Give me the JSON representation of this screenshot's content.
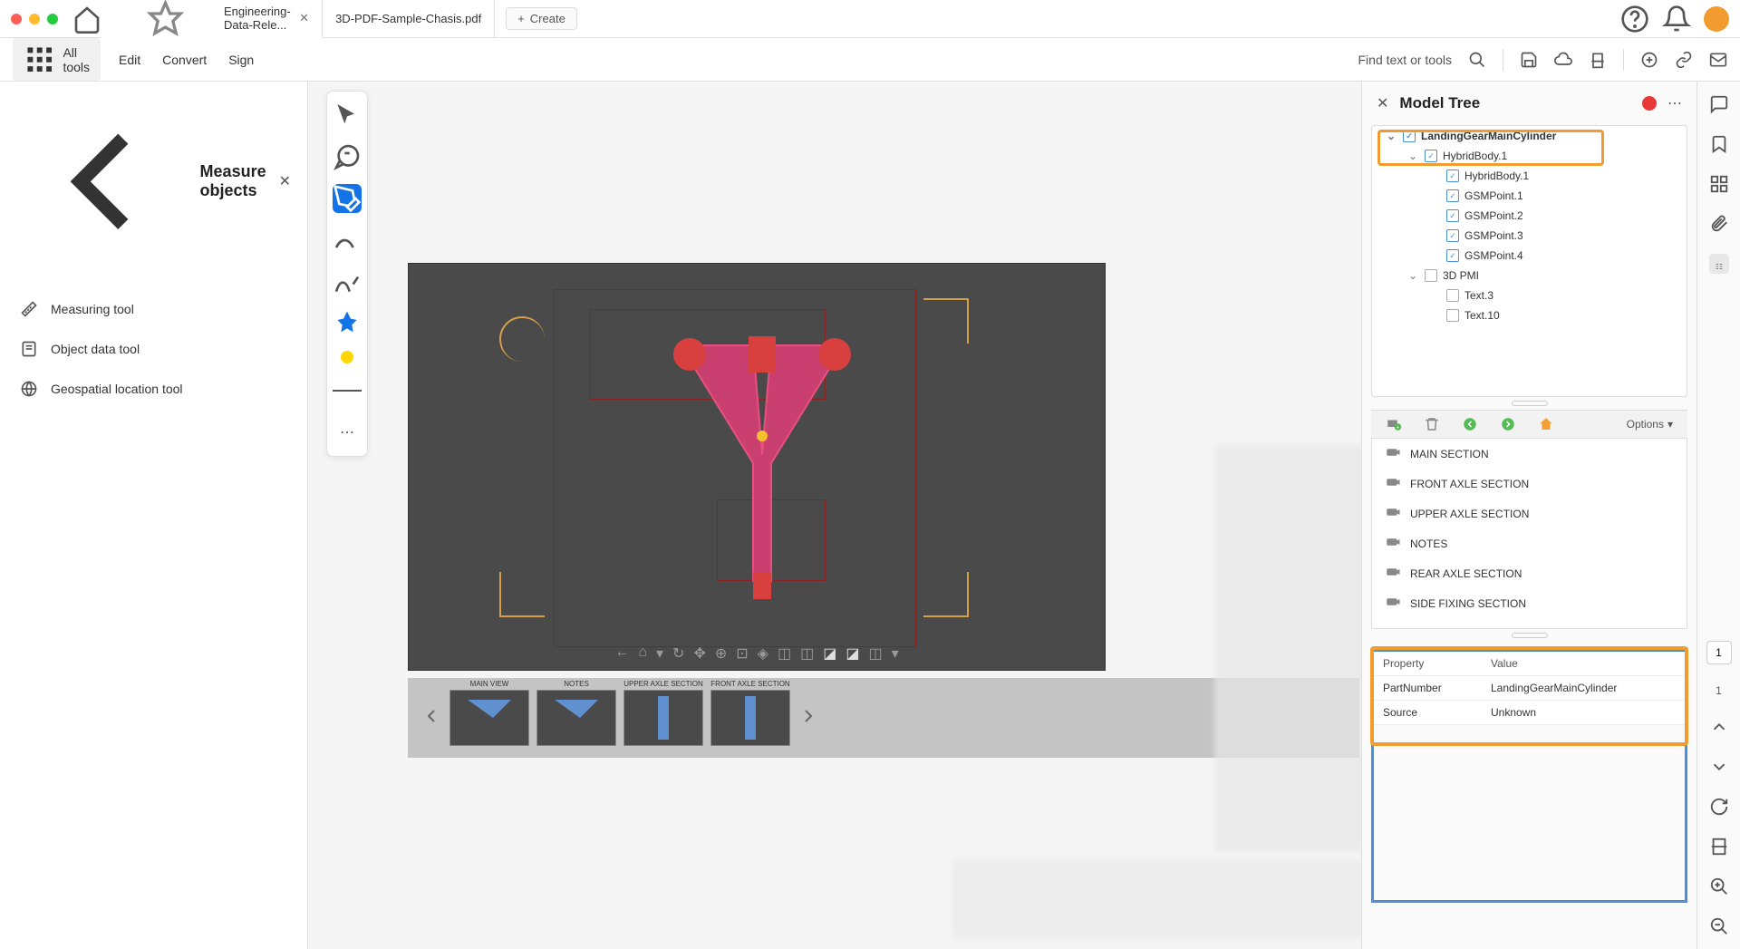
{
  "titlebar": {
    "tab1": "Engineering-Data-Rele...",
    "tab2": "3D-PDF-Sample-Chasis.pdf",
    "create": "Create"
  },
  "toolbar": {
    "all_tools": "All tools",
    "edit": "Edit",
    "convert": "Convert",
    "sign": "Sign",
    "find": "Find text or tools"
  },
  "left_panel": {
    "title": "Measure objects",
    "items": [
      "Measuring tool",
      "Object data tool",
      "Geospatial location tool"
    ]
  },
  "thumbs": [
    "MAIN VIEW",
    "NOTES",
    "UPPER AXLE SECTION",
    "FRONT AXLE SECTION"
  ],
  "model_tree": {
    "title": "Model Tree",
    "root": "LandingGearMainCylinder",
    "items": [
      {
        "label": "HybridBody.1",
        "level": 2,
        "checked": true,
        "chev": true
      },
      {
        "label": "HybridBody.1",
        "level": 3,
        "checked": true
      },
      {
        "label": "GSMPoint.1",
        "level": 3,
        "checked": true
      },
      {
        "label": "GSMPoint.2",
        "level": 3,
        "checked": true
      },
      {
        "label": "GSMPoint.3",
        "level": 3,
        "checked": true
      },
      {
        "label": "GSMPoint.4",
        "level": 3,
        "checked": true
      },
      {
        "label": "3D PMI",
        "level": 2,
        "checked": false,
        "chev": true
      },
      {
        "label": "Text.3",
        "level": 3,
        "checked": false
      },
      {
        "label": "Text.10",
        "level": 3,
        "checked": false
      }
    ]
  },
  "views": {
    "options": "Options",
    "items": [
      "MAIN SECTION",
      "FRONT AXLE SECTION",
      "UPPER AXLE SECTION",
      "NOTES",
      "REAR AXLE SECTION",
      "SIDE FIXING SECTION"
    ]
  },
  "properties": {
    "col1": "Property",
    "col2": "Value",
    "rows": [
      {
        "p": "PartNumber",
        "v": "LandingGearMainCylinder"
      },
      {
        "p": "Source",
        "v": "Unknown"
      }
    ]
  },
  "page": {
    "current": "1",
    "total": "1"
  }
}
